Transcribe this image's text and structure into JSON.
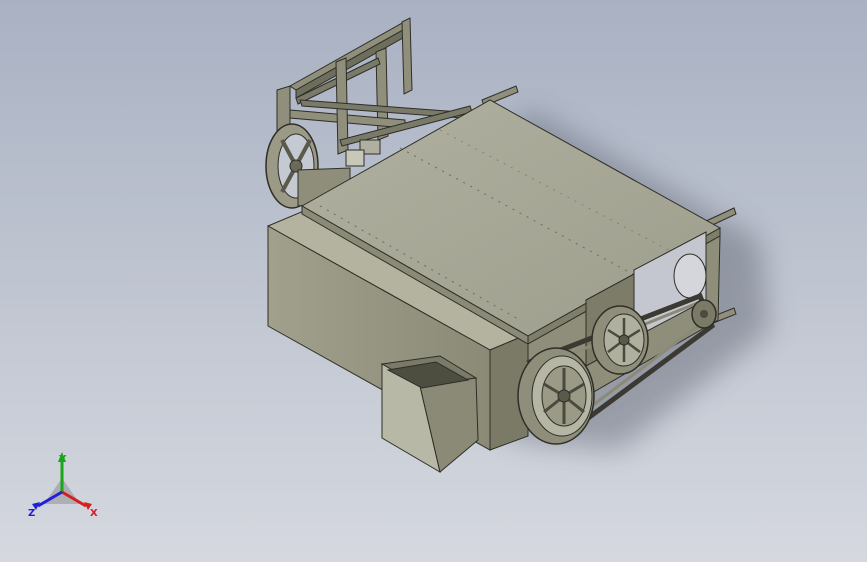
{
  "viewport": {
    "background_top": "#a9b1c3",
    "background_bottom": "#d5d8df"
  },
  "model": {
    "body_color": "#9c9c88",
    "body_dark": "#747462",
    "top_color": "#a6a696",
    "edge_color": "#2e2e28"
  },
  "triad": {
    "x_label": "X",
    "y_label": "Y",
    "z_label": "Z",
    "x_color": "#d42020",
    "y_color": "#1aa51a",
    "z_color": "#2020d4"
  }
}
